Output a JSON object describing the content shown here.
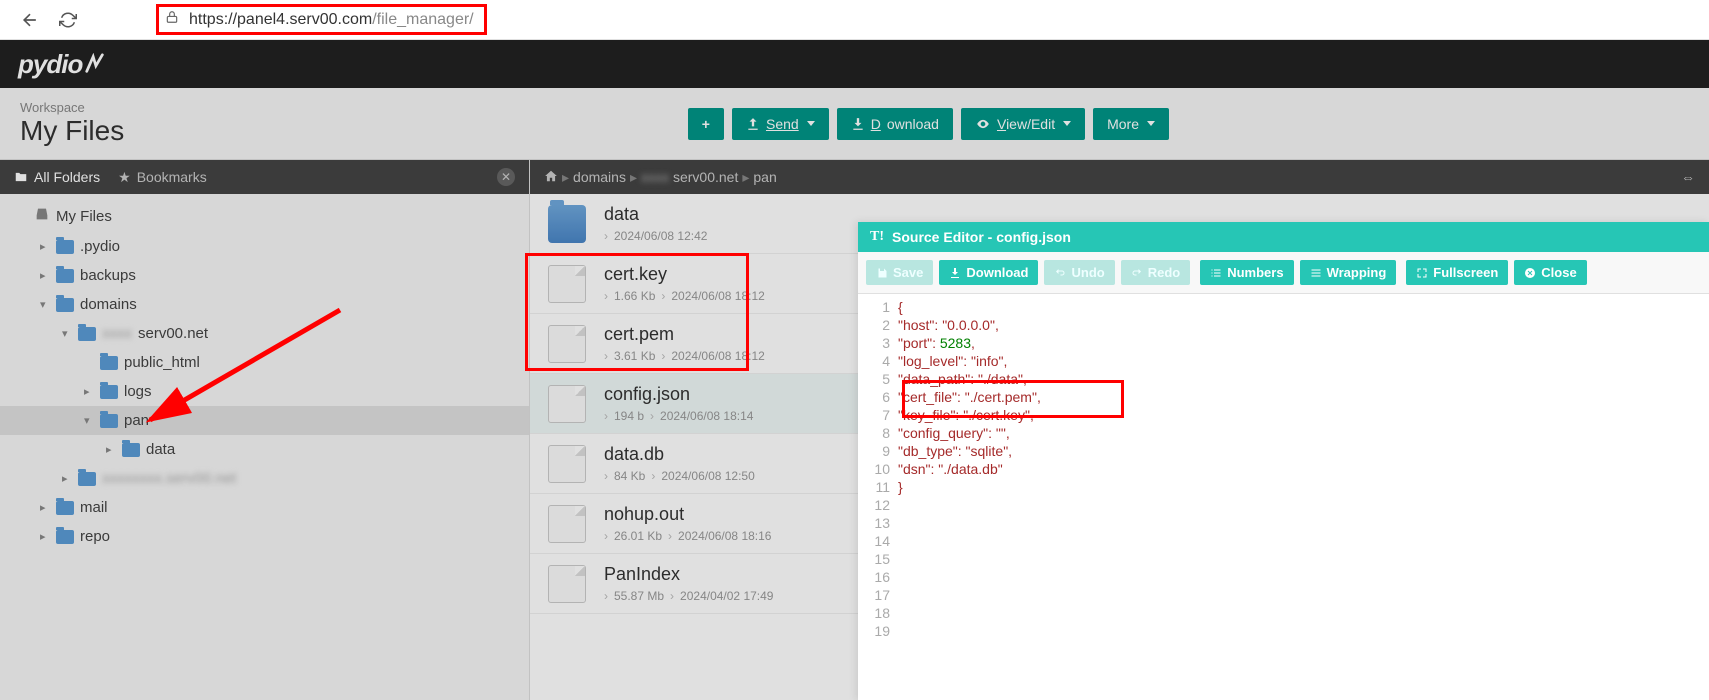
{
  "browser": {
    "url_host": "https://panel4.serv00.com",
    "url_path": "/file_manager/"
  },
  "logo": "pydio",
  "workspace": {
    "label": "Workspace",
    "title": "My Files"
  },
  "actions": {
    "new": "+",
    "send": "Send",
    "download": "Download",
    "viewedit": "View/Edit",
    "more": "More"
  },
  "sidebar": {
    "tab_all": "All Folders",
    "tab_bookmarks": "Bookmarks",
    "tree": [
      {
        "label": "My Files",
        "depth": 1,
        "icon": "drive",
        "expand": ""
      },
      {
        "label": ".pydio",
        "depth": 2,
        "icon": "folder",
        "expand": "▸"
      },
      {
        "label": "backups",
        "depth": 2,
        "icon": "folder",
        "expand": "▸"
      },
      {
        "label": "domains",
        "depth": 2,
        "icon": "folder",
        "expand": "▾"
      },
      {
        "label": "serv00.net",
        "depth": 3,
        "icon": "folder",
        "expand": "▾",
        "prefix_blur": "xxxx"
      },
      {
        "label": "public_html",
        "depth": 4,
        "icon": "folder",
        "expand": ""
      },
      {
        "label": "logs",
        "depth": 4,
        "icon": "folder",
        "expand": "▸"
      },
      {
        "label": "pan",
        "depth": 4,
        "icon": "folder",
        "expand": "▾",
        "selected": true
      },
      {
        "label": "data",
        "depth": 5,
        "icon": "folder",
        "expand": "▸"
      },
      {
        "label": "",
        "depth": 3,
        "icon": "folder",
        "expand": "▸",
        "blur": true
      },
      {
        "label": "mail",
        "depth": 2,
        "icon": "folder",
        "expand": "▸"
      },
      {
        "label": "repo",
        "depth": 2,
        "icon": "folder",
        "expand": "▸"
      }
    ]
  },
  "breadcrumb": {
    "home": "⌂",
    "parts": [
      "domains",
      "serv00.net",
      "pan"
    ]
  },
  "files": [
    {
      "name": "data",
      "type": "folder",
      "size": "",
      "date": "2024/06/08 12:42"
    },
    {
      "name": "cert.key",
      "type": "file",
      "size": "1.66 Kb",
      "date": "2024/06/08 18:12"
    },
    {
      "name": "cert.pem",
      "type": "file",
      "size": "3.61 Kb",
      "date": "2024/06/08 18:12"
    },
    {
      "name": "config.json",
      "type": "file",
      "size": "194 b",
      "date": "2024/06/08 18:14",
      "selected": true
    },
    {
      "name": "data.db",
      "type": "file",
      "size": "84 Kb",
      "date": "2024/06/08 12:50"
    },
    {
      "name": "nohup.out",
      "type": "file",
      "size": "26.01 Kb",
      "date": "2024/06/08 18:16"
    },
    {
      "name": "PanIndex",
      "type": "file",
      "size": "55.87 Mb",
      "date": "2024/04/02 17:49"
    }
  ],
  "editor": {
    "title": "Source Editor - config.json",
    "buttons": {
      "save": "Save",
      "download": "Download",
      "undo": "Undo",
      "redo": "Redo",
      "numbers": "Numbers",
      "wrapping": "Wrapping",
      "fullscreen": "Fullscreen",
      "close": "Close"
    },
    "line_count": 19,
    "content": {
      "host": "0.0.0.0",
      "port": 5283,
      "log_level": "info",
      "data_path": "./data",
      "cert_file": "./cert.pem",
      "key_file": "./cert.key",
      "config_query": "",
      "db_type": "sqlite",
      "dsn": "./data.db"
    }
  }
}
